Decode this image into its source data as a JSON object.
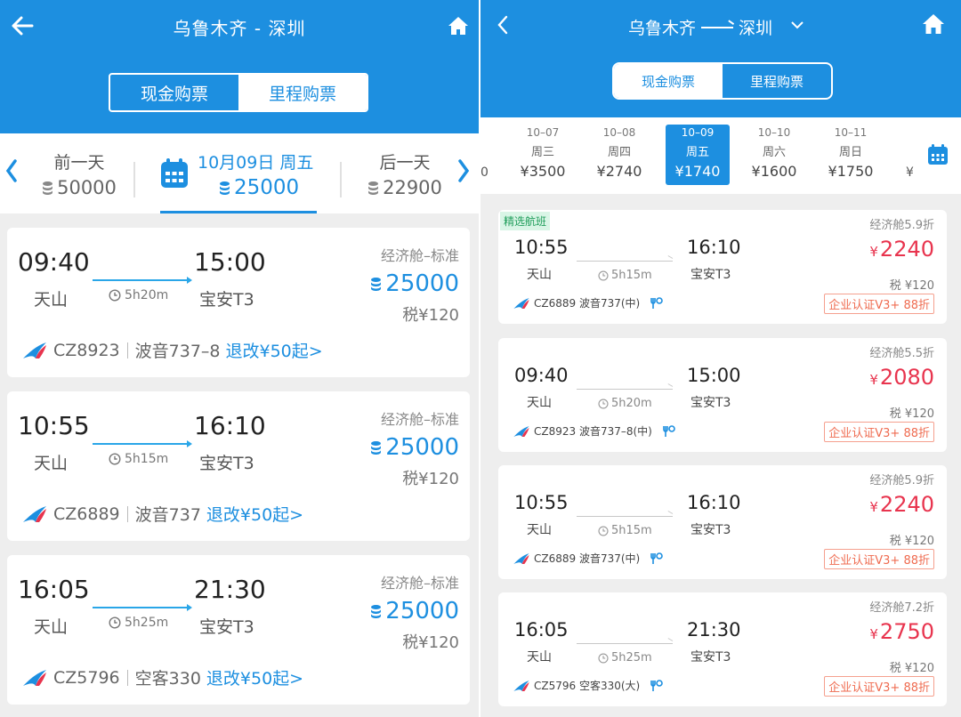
{
  "left": {
    "header": {
      "title": "乌鲁木齐 - 深圳"
    },
    "toggle": {
      "cash": "现金购票",
      "miles": "里程购票"
    },
    "datebar": {
      "prev": {
        "label": "前一天",
        "points": "50000"
      },
      "current": {
        "date": "10月09日 周五",
        "points": "25000"
      },
      "next": {
        "label": "后一天",
        "points": "22900"
      }
    },
    "flights": [
      {
        "dep_time": "09:40",
        "dep_airport": "天山",
        "arr_time": "15:00",
        "arr_airport": "宝安T3",
        "duration": "5h20m",
        "cabin": "经济舱–标准",
        "points": "25000",
        "tax": "税¥120",
        "flight_no": "CZ8923",
        "aircraft": "波音737–8",
        "change": "退改¥50起>"
      },
      {
        "dep_time": "10:55",
        "dep_airport": "天山",
        "arr_time": "16:10",
        "arr_airport": "宝安T3",
        "duration": "5h15m",
        "cabin": "经济舱–标准",
        "points": "25000",
        "tax": "税¥120",
        "flight_no": "CZ6889",
        "aircraft": "波音737",
        "change": "退改¥50起>"
      },
      {
        "dep_time": "16:05",
        "dep_airport": "天山",
        "arr_time": "21:30",
        "arr_airport": "宝安T3",
        "duration": "5h25m",
        "cabin": "经济舱–标准",
        "points": "25000",
        "tax": "税¥120",
        "flight_no": "CZ5796",
        "aircraft": "空客330",
        "change": "退改¥50起>"
      }
    ]
  },
  "right": {
    "header": {
      "from": "乌鲁木齐",
      "to": "深圳"
    },
    "toggle": {
      "cash": "现金购票",
      "miles": "里程购票"
    },
    "dates": [
      {
        "date": "10–07",
        "weekday": "周三",
        "price": "¥3500"
      },
      {
        "date": "10–08",
        "weekday": "周四",
        "price": "¥2740"
      },
      {
        "date": "10–09",
        "weekday": "周五",
        "price": "¥1740"
      },
      {
        "date": "10–10",
        "weekday": "周六",
        "price": "¥1600"
      },
      {
        "date": "10–11",
        "weekday": "周日",
        "price": "¥1750"
      }
    ],
    "edge_left": "0",
    "edge_right": "¥",
    "flights": [
      {
        "tag": "精选航班",
        "dep_time": "10:55",
        "dep_airport": "天山",
        "arr_time": "16:10",
        "arr_airport": "宝安T3",
        "duration": "5h15m",
        "discount": "经济舱5.9折",
        "price": "2240",
        "tax": "税 ¥120",
        "badge": "企业认证V3+ 88折",
        "flight_info": "CZ6889 波音737(中)"
      },
      {
        "tag": "",
        "dep_time": "09:40",
        "dep_airport": "天山",
        "arr_time": "15:00",
        "arr_airport": "宝安T3",
        "duration": "5h20m",
        "discount": "经济舱5.5折",
        "price": "2080",
        "tax": "税 ¥120",
        "badge": "企业认证V3+ 88折",
        "flight_info": "CZ8923 波音737–8(中)"
      },
      {
        "tag": "",
        "dep_time": "10:55",
        "dep_airport": "天山",
        "arr_time": "16:10",
        "arr_airport": "宝安T3",
        "duration": "5h15m",
        "discount": "经济舱5.9折",
        "price": "2240",
        "tax": "税 ¥120",
        "badge": "企业认证V3+ 88折",
        "flight_info": "CZ6889 波音737(中)"
      },
      {
        "tag": "",
        "dep_time": "16:05",
        "dep_airport": "天山",
        "arr_time": "21:30",
        "arr_airport": "宝安T3",
        "duration": "5h25m",
        "discount": "经济舱7.2折",
        "price": "2750",
        "tax": "税 ¥120",
        "badge": "企业认证V3+ 88折",
        "flight_info": "CZ5796 空客330(大)"
      }
    ],
    "currency": "¥"
  },
  "colors": {
    "brand": "#1d8fe0",
    "price_red": "#e8344e",
    "badge_orange": "#ef6b50",
    "tag_green": "#1f9d5a"
  }
}
